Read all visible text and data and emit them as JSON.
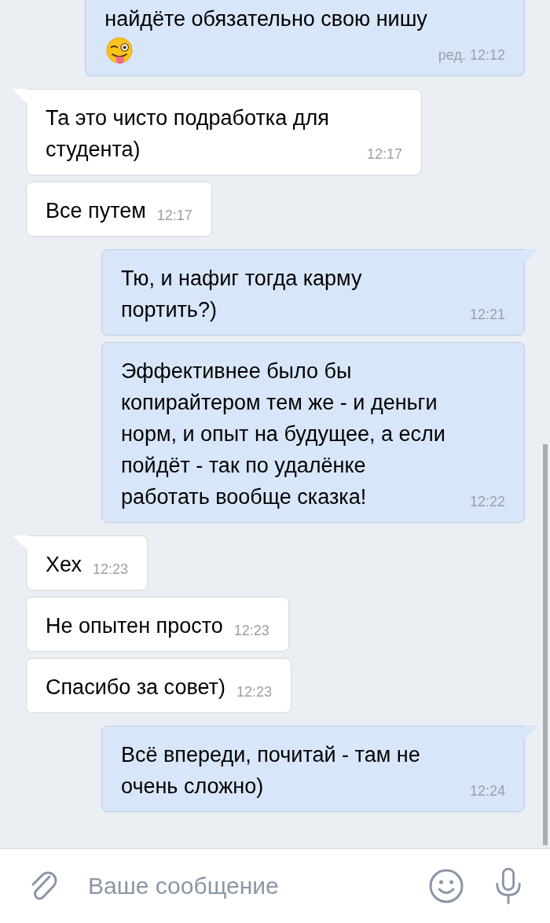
{
  "messages": [
    {
      "outgoing": true,
      "tail": false,
      "text": "найдёте обязательно свою нишу",
      "emoji": true,
      "time": "ред. 12:12"
    },
    {
      "outgoing": false,
      "tail": true,
      "text": "Та это чисто подработка для студента)",
      "time": "12:17"
    },
    {
      "outgoing": false,
      "tail": false,
      "text": "Все путем",
      "time": "12:17"
    },
    {
      "outgoing": true,
      "tail": true,
      "text": "Тю, и нафиг тогда карму портить?)",
      "time": "12:21"
    },
    {
      "outgoing": true,
      "tail": false,
      "text": "Эффективнее было бы копирайтером тем же - и деньги норм, и опыт на будущее, а если пойдёт - так по удалёнке работать вообще сказка!",
      "time": "12:22"
    },
    {
      "outgoing": false,
      "tail": true,
      "text": "Хех",
      "time": "12:23"
    },
    {
      "outgoing": false,
      "tail": false,
      "text": "Не опытен просто",
      "time": "12:23"
    },
    {
      "outgoing": false,
      "tail": false,
      "text": "Спасибо за совет)",
      "time": "12:23"
    },
    {
      "outgoing": true,
      "tail": true,
      "text": "Всё впереди, почитай - там не очень сложно)",
      "time": "12:24"
    }
  ],
  "composer": {
    "placeholder": "Ваше сообщение"
  }
}
